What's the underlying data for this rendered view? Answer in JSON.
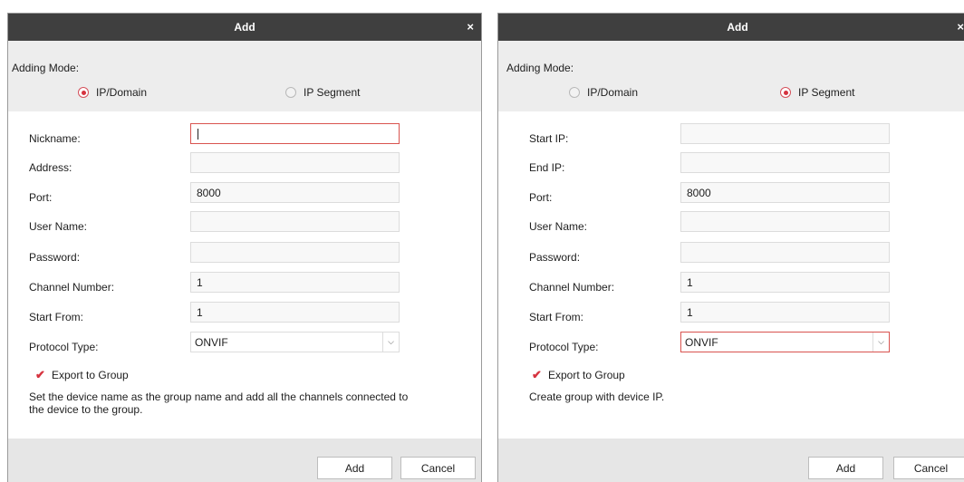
{
  "left_dialog": {
    "title": "Add",
    "close_glyph": "×",
    "adding_mode_label": "Adding Mode:",
    "modes": [
      {
        "label": "IP/Domain",
        "selected": true
      },
      {
        "label": "IP Segment",
        "selected": false
      }
    ],
    "fields": [
      {
        "label": "Nickname:",
        "value": ""
      },
      {
        "label": "Address:",
        "value": ""
      },
      {
        "label": "Port:",
        "value": "8000"
      },
      {
        "label": "User Name:",
        "value": ""
      },
      {
        "label": "Password:",
        "value": ""
      },
      {
        "label": "Channel Number:",
        "value": "1"
      },
      {
        "label": "Start From:",
        "value": "1"
      }
    ],
    "protocol_label": "Protocol Type:",
    "protocol_value": "ONVIF",
    "export_label": "Export to Group",
    "export_checked": true,
    "note": "Set the device name as the group name and add all the channels connected to the device to the group.",
    "add_button": "Add",
    "cancel_button": "Cancel"
  },
  "right_dialog": {
    "title": "Add",
    "close_glyph": "×",
    "adding_mode_label": "Adding Mode:",
    "modes": [
      {
        "label": "IP/Domain",
        "selected": false
      },
      {
        "label": "IP Segment",
        "selected": true
      }
    ],
    "fields": [
      {
        "label": "Start IP:",
        "value": ""
      },
      {
        "label": "End IP:",
        "value": ""
      },
      {
        "label": "Port:",
        "value": "8000"
      },
      {
        "label": "User Name:",
        "value": ""
      },
      {
        "label": "Password:",
        "value": ""
      },
      {
        "label": "Channel Number:",
        "value": "1"
      },
      {
        "label": "Start From:",
        "value": "1"
      }
    ],
    "protocol_label": "Protocol Type:",
    "protocol_value": "ONVIF",
    "export_label": "Export to Group",
    "export_checked": true,
    "note": "Create group with device IP.",
    "add_button": "Add",
    "cancel_button": "Cancel"
  },
  "icons": {
    "close": "close-icon",
    "radio_on": "radio-selected-icon",
    "radio_off": "radio-unselected-icon",
    "check": "checkmark-icon",
    "dropdown": "chevron-down-icon"
  },
  "colors": {
    "titlebar": "#3f3f3f",
    "accent": "#d6333f",
    "dialog_bg": "#ededed",
    "form_bg": "#ffffff",
    "footer_bg": "#e6e6e6"
  }
}
